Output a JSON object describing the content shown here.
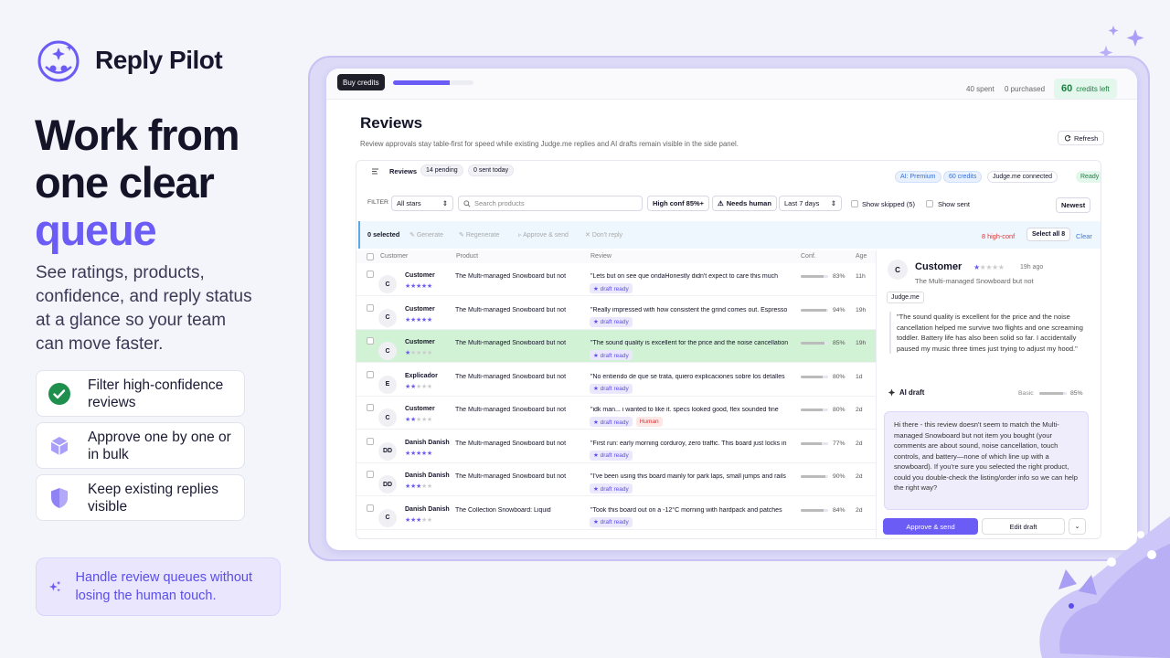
{
  "brand": {
    "name": "Reply Pilot"
  },
  "headline": {
    "line1": "Work from",
    "line2": "one clear",
    "accent": "queue"
  },
  "subtitle": "See ratings, products, confidence, and reply status at a glance so your team can move faster.",
  "features": [
    {
      "label": "Filter high-confidence reviews",
      "icon": "check-circle-icon"
    },
    {
      "label": "Approve one by one or in bulk",
      "icon": "cube-icon"
    },
    {
      "label": "Keep existing replies visible",
      "icon": "shield-icon"
    }
  ],
  "callout": {
    "text": "Handle review queues without losing the human touch.",
    "icon": "sparkles-icon"
  },
  "colors": {
    "accent": "#6b5cf6",
    "success": "#1f8f4e",
    "danger": "#d33333",
    "selected_row": "#d2f2d6"
  },
  "app": {
    "topbar": {
      "buy_label": "Buy credits",
      "credit_usage": 0.7,
      "spent": "40 spent",
      "purchased": "0 purchased",
      "credits_left_num": "60",
      "credits_left_label": "credits left"
    },
    "title": "Reviews",
    "description": "Review approvals stay table-first for speed while existing Judge.me replies and AI drafts remain visible in the side panel.",
    "refresh_label": "Refresh",
    "card": {
      "label": "Reviews",
      "pending": "14 pending",
      "sent_today": "0 sent today",
      "ai_plan": "AI: Premium",
      "credits": "60 credits",
      "connection": "Judge.me connected",
      "status": "Ready"
    },
    "filters": {
      "label": "FILTER",
      "stars": "All stars",
      "search_placeholder": "Search products",
      "high_conf": "High conf 85%+",
      "needs_human": "Needs human",
      "range": "Last 7 days",
      "show_skipped": "Show skipped (5)",
      "show_sent": "Show sent",
      "sort": "Newest"
    },
    "bulk": {
      "selected": "0 selected",
      "generate": "Generate",
      "regenerate": "Regenerate",
      "approve_send": "Approve & send",
      "dont_reply": "Don't reply",
      "high_conf_count": "8 high-conf",
      "select_all": "Select all 8",
      "clear": "Clear"
    },
    "columns": [
      "Customer",
      "Product",
      "Review",
      "Conf.",
      "Age"
    ],
    "rows": [
      {
        "initials": "C",
        "name": "Customer",
        "rating": 5,
        "product": "The Multi-managed Snowboard but not",
        "review": "\"Lets but on see que ondaHonestly didn't expect to care this much",
        "tags": [
          "★ draft ready"
        ],
        "conf": 83,
        "conf_label": "83%",
        "age": "11h"
      },
      {
        "initials": "C",
        "name": "Customer",
        "rating": 5,
        "product": "The Multi-managed Snowboard but not",
        "review": "\"Really impressed with how consistent the grind comes out. Espresso",
        "tags": [
          "★ draft ready"
        ],
        "conf": 94,
        "conf_label": "94%",
        "age": "19h"
      },
      {
        "initials": "C",
        "name": "Customer",
        "rating": 1,
        "product": "The Multi-managed Snowboard but not",
        "review": "\"The sound quality is excellent for the price and the noise cancellation",
        "tags": [
          "★ draft ready"
        ],
        "conf": 85,
        "conf_label": "85%",
        "age": "19h",
        "selected": true
      },
      {
        "initials": "E",
        "name": "Explicador",
        "rating": 2,
        "product": "The Multi-managed Snowboard but not",
        "review": "\"No entiendo de que se trata, quiero explicaciones sobre los detalles",
        "tags": [
          "★ draft ready"
        ],
        "conf": 80,
        "conf_label": "80%",
        "age": "1d"
      },
      {
        "initials": "C",
        "name": "Customer",
        "rating": 2,
        "product": "The Multi-managed Snowboard but not",
        "review": "\"idk man... i wanted to like it. specs looked good, flex sounded fine",
        "tags": [
          "★ draft ready",
          "Human"
        ],
        "conf": 80,
        "conf_label": "80%",
        "age": "2d"
      },
      {
        "initials": "DD",
        "name": "Danish Danish",
        "rating": 5,
        "product": "The Multi-managed Snowboard but not",
        "review": "\"First run: early morning corduroy, zero traffic. This board just locks in",
        "tags": [
          "★ draft ready"
        ],
        "conf": 77,
        "conf_label": "77%",
        "age": "2d"
      },
      {
        "initials": "DD",
        "name": "Danish Danish",
        "rating": 3,
        "product": "The Multi-managed Snowboard but not",
        "review": "\"I've been using this board mainly for park laps, small jumps and rails",
        "tags": [
          "★ draft ready"
        ],
        "conf": 90,
        "conf_label": "90%",
        "age": "2d"
      },
      {
        "initials": "C",
        "name": "Danish Danish",
        "rating": 3,
        "product": "The Collection Snowboard: Liquid",
        "review": "\"Took this board out on a -12°C morning with hardpack and patches",
        "tags": [
          "★ draft ready"
        ],
        "conf": 84,
        "conf_label": "84%",
        "age": "2d"
      }
    ],
    "detail": {
      "initials": "C",
      "name": "Customer",
      "rating": 1,
      "age": "19h ago",
      "product": "The Multi-managed Snowboard but not",
      "source": "Judge.me",
      "quote": "\"The sound quality is excellent for the price and the noise cancellation helped me survive two flights and one screaming toddler. Battery life has also been solid so far. I accidentally paused my music three times just trying to adjust my hood.\"",
      "ai_label": "AI draft",
      "basic_label": "Basic",
      "basic_conf": 85,
      "basic_pct": "85%",
      "draft": "Hi there - this review doesn't seem to match the Multi-managed Snowboard but not item you bought (your comments are about sound, noise cancellation, touch controls, and battery—none of which line up with a snowboard). If you're sure you selected the right product, could you double-check the listing/order info so we can help the right way?",
      "approve_label": "Approve & send",
      "edit_label": "Edit draft"
    }
  }
}
